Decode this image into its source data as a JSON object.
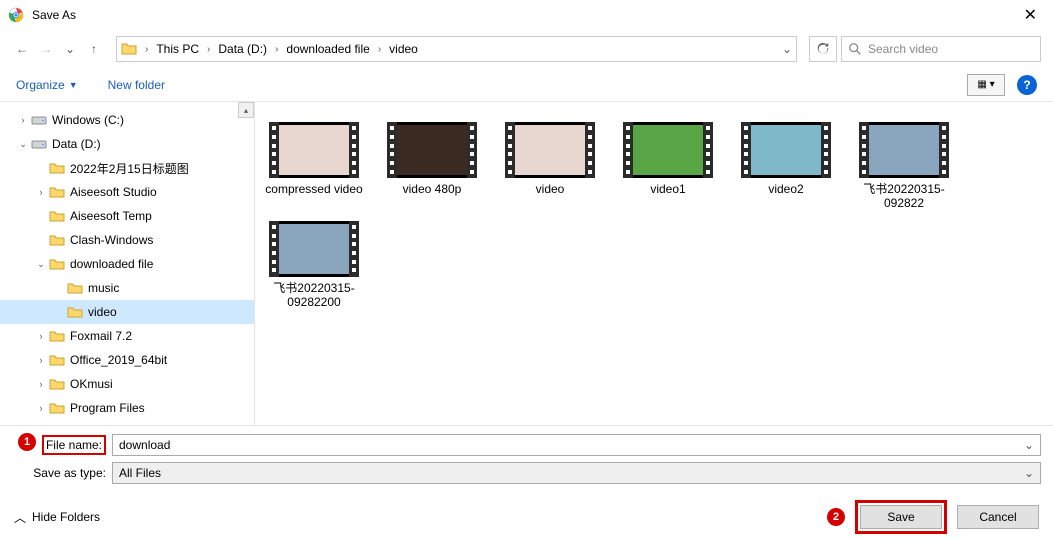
{
  "title_bar": {
    "title": "Save As"
  },
  "nav": {
    "breadcrumbs": [
      "This PC",
      "Data (D:)",
      "downloaded file",
      "video"
    ],
    "search_placeholder": "Search video"
  },
  "toolbar": {
    "organize": "Organize",
    "new_folder": "New folder"
  },
  "tree": [
    {
      "depth": 0,
      "exp": ">",
      "icon": "drive",
      "label": "Windows (C:)"
    },
    {
      "depth": 0,
      "exp": "v",
      "icon": "drive",
      "label": "Data (D:)"
    },
    {
      "depth": 1,
      "exp": "",
      "icon": "folder",
      "label": "2022年2月15日标题图"
    },
    {
      "depth": 1,
      "exp": ">",
      "icon": "folder",
      "label": "Aiseesoft Studio"
    },
    {
      "depth": 1,
      "exp": "",
      "icon": "folder",
      "label": "Aiseesoft Temp"
    },
    {
      "depth": 1,
      "exp": "",
      "icon": "folder",
      "label": "Clash-Windows"
    },
    {
      "depth": 1,
      "exp": "v",
      "icon": "folder",
      "label": "downloaded file"
    },
    {
      "depth": 2,
      "exp": "",
      "icon": "folder",
      "label": "music"
    },
    {
      "depth": 2,
      "exp": "",
      "icon": "folder",
      "label": "video",
      "selected": true
    },
    {
      "depth": 1,
      "exp": ">",
      "icon": "folder",
      "label": "Foxmail 7.2"
    },
    {
      "depth": 1,
      "exp": ">",
      "icon": "folder",
      "label": "Office_2019_64bit"
    },
    {
      "depth": 1,
      "exp": ">",
      "icon": "folder",
      "label": "OKmusi"
    },
    {
      "depth": 1,
      "exp": ">",
      "icon": "folder",
      "label": "Program Files"
    }
  ],
  "items": [
    {
      "label": "compressed video",
      "thumb_bg": "#e8d6d0"
    },
    {
      "label": "video 480p",
      "thumb_bg": "#3a2a22"
    },
    {
      "label": "video",
      "thumb_bg": "#e8d6d0"
    },
    {
      "label": "video1",
      "thumb_bg": "#5aa646"
    },
    {
      "label": "video2",
      "thumb_bg": "#7fb8c9"
    },
    {
      "label": "飞书20220315-092822",
      "thumb_bg": "#8aa6bf"
    },
    {
      "label": "飞书20220315-09282200",
      "thumb_bg": "#8aa6bf"
    }
  ],
  "fields": {
    "file_name_label": "File name:",
    "file_name_value": "download",
    "save_type_label": "Save as type:",
    "save_type_value": "All Files"
  },
  "actions": {
    "hide_folders": "Hide Folders",
    "save": "Save",
    "cancel": "Cancel"
  },
  "annotations": {
    "badge1": "1",
    "badge2": "2"
  }
}
